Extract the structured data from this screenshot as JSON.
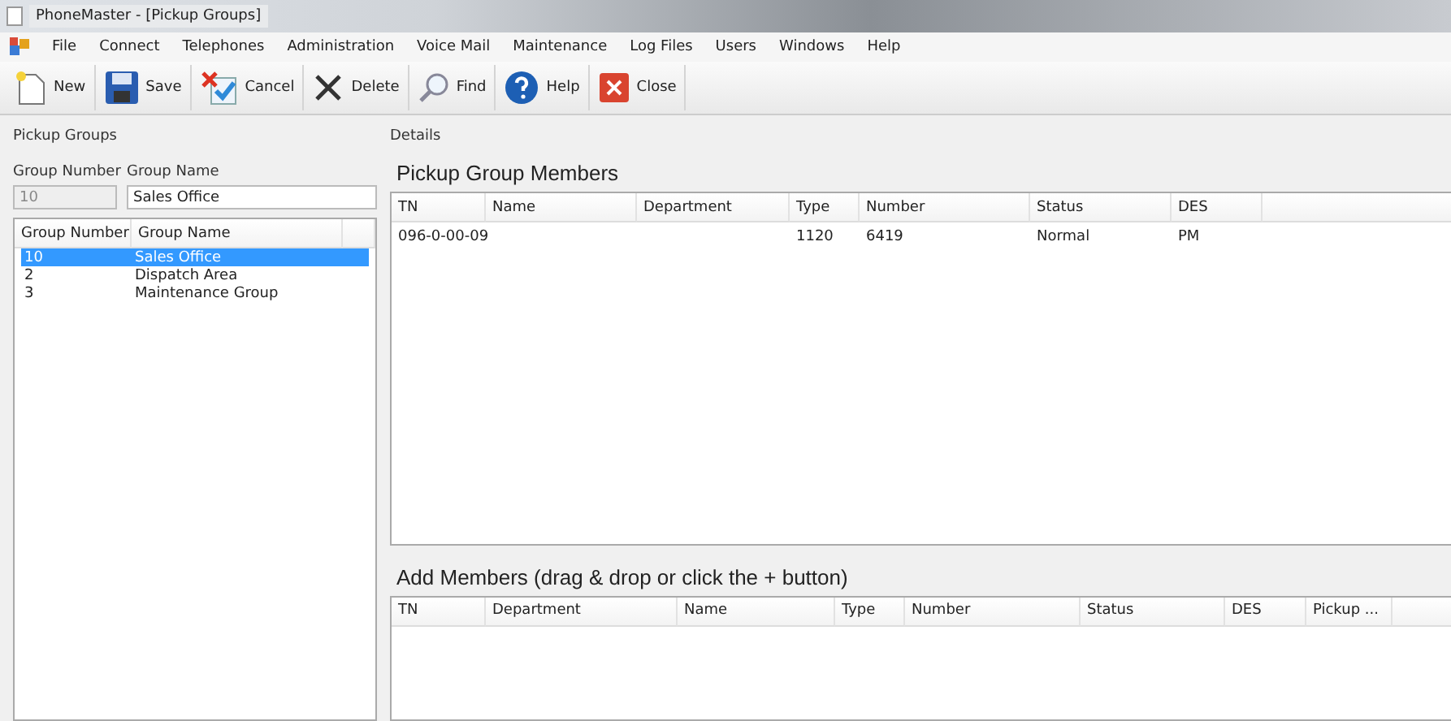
{
  "window": {
    "title": "PhoneMaster - [Pickup Groups]"
  },
  "menu": [
    "File",
    "Connect",
    "Telephones",
    "Administration",
    "Voice Mail",
    "Maintenance",
    "Log Files",
    "Users",
    "Windows",
    "Help"
  ],
  "toolbar": [
    {
      "kind": "new",
      "label": "New"
    },
    {
      "kind": "save",
      "label": "Save"
    },
    {
      "kind": "cancel",
      "label": "Cancel"
    },
    {
      "kind": "delete",
      "label": "Delete"
    },
    {
      "kind": "find",
      "label": "Find"
    },
    {
      "kind": "help",
      "label": "Help"
    },
    {
      "kind": "close",
      "label": "Close"
    }
  ],
  "left_panel": {
    "title": "Pickup Groups",
    "number_label": "Group Number",
    "name_label": "Group Name",
    "number_value": "10",
    "name_value": "Sales Office",
    "list": {
      "columns": [
        "Group Number",
        "Group Name"
      ],
      "rows": [
        {
          "number": "10",
          "name": "Sales Office",
          "selected": true
        },
        {
          "number": "2",
          "name": "Dispatch Area",
          "selected": false
        },
        {
          "number": "3",
          "name": "Maintenance Group",
          "selected": false
        }
      ]
    }
  },
  "details": {
    "title": "Details",
    "members": {
      "title": "Pickup Group Members",
      "columns": [
        "TN",
        "Name",
        "Department",
        "Type",
        "Number",
        "Status",
        "DES"
      ],
      "rows": [
        [
          "096-0-00-09",
          "",
          "",
          "1120",
          "6419",
          "Normal",
          "PM"
        ]
      ]
    },
    "add_members": {
      "title": "Add Members (drag & drop or click the + button)",
      "columns": [
        "TN",
        "Department",
        "Name",
        "Type",
        "Number",
        "Status",
        "DES",
        "Pickup ..."
      ]
    }
  }
}
